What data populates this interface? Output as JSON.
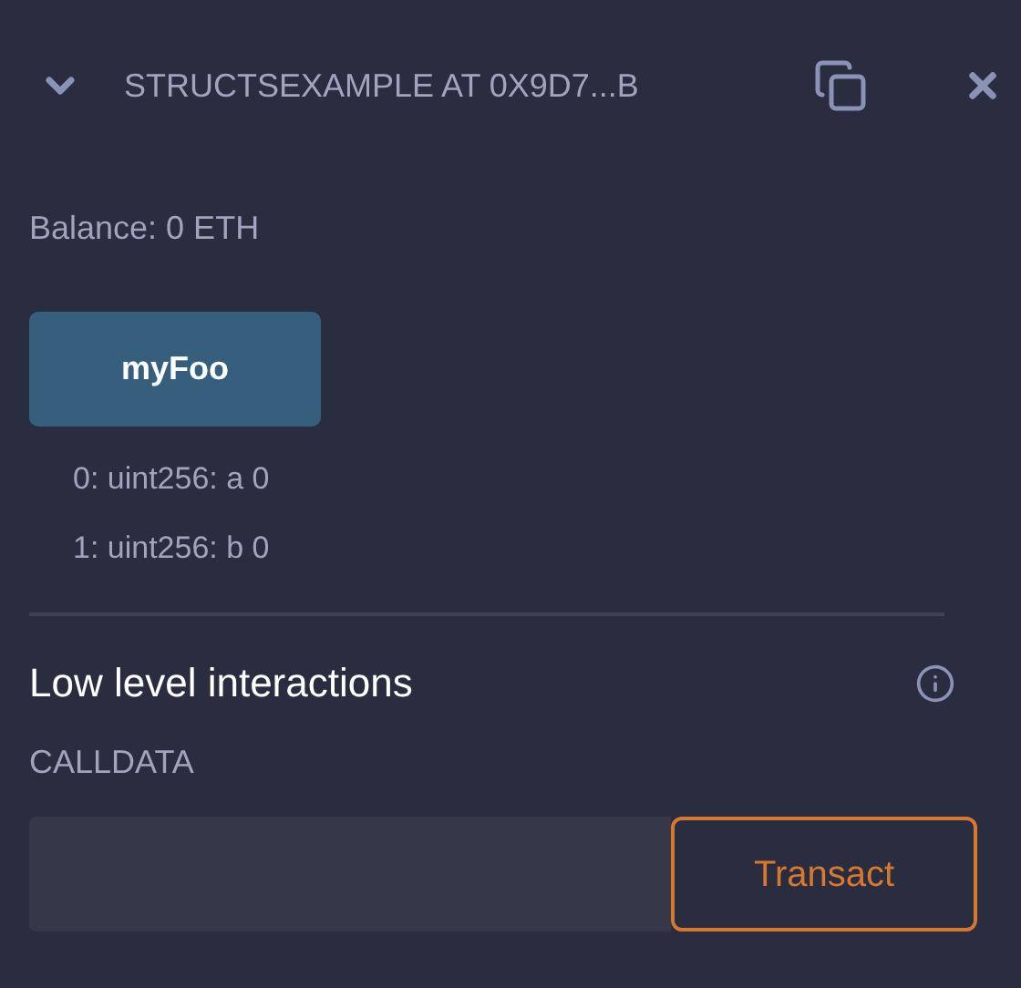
{
  "header": {
    "title": "STRUCTSEXAMPLE AT 0X9D7...B",
    "expanded": true
  },
  "balance": "Balance: 0 ETH",
  "function_button": {
    "label": "myFoo"
  },
  "outputs": [
    "0: uint256: a 0",
    "1: uint256: b 0"
  ],
  "low_level": {
    "title": "Low level interactions",
    "calldata_label": "CALLDATA",
    "button": "Transact"
  }
}
